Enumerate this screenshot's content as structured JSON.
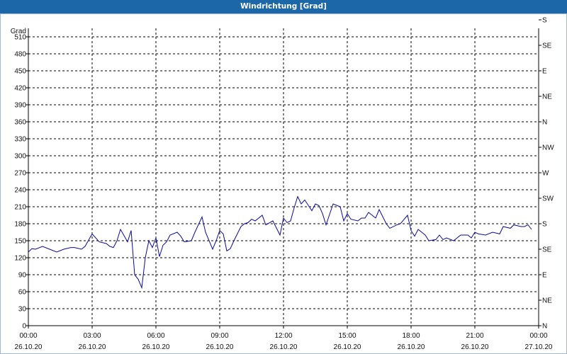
{
  "window": {
    "title": "Windrichtung [Grad]"
  },
  "colors": {
    "title_bar": "#1c67a8",
    "line": "#0a0a9c",
    "grid": "#000000",
    "axis": "#000000"
  },
  "chart_data": {
    "type": "line",
    "title": "Windrichtung [Grad]",
    "ylabel": "Grad",
    "ylim": [
      0,
      525
    ],
    "y_ticks": [
      0,
      30,
      60,
      90,
      120,
      150,
      180,
      210,
      240,
      270,
      300,
      330,
      360,
      390,
      420,
      450,
      480,
      510
    ],
    "y2_ticks": [
      {
        "value": 0,
        "label": "N"
      },
      {
        "value": 45,
        "label": "NE"
      },
      {
        "value": 90,
        "label": "E"
      },
      {
        "value": 135,
        "label": "SE"
      },
      {
        "value": 180,
        "label": "S"
      },
      {
        "value": 225,
        "label": "SW"
      },
      {
        "value": 270,
        "label": "W"
      },
      {
        "value": 315,
        "label": "NW"
      },
      {
        "value": 360,
        "label": "N"
      },
      {
        "value": 405,
        "label": "NE"
      },
      {
        "value": 450,
        "label": "E"
      },
      {
        "value": 495,
        "label": "SE"
      },
      {
        "value": 540,
        "label": "S"
      }
    ],
    "xlim": [
      "26.10.20 00:00",
      "27.10.20 00:00"
    ],
    "x_ticks": [
      {
        "time": "00:00",
        "date": "26.10.20"
      },
      {
        "time": "03:00",
        "date": "26.10.20"
      },
      {
        "time": "06:00",
        "date": "26.10.20"
      },
      {
        "time": "09:00",
        "date": "26.10.20"
      },
      {
        "time": "12:00",
        "date": "26.10.20"
      },
      {
        "time": "15:00",
        "date": "26.10.20"
      },
      {
        "time": "18:00",
        "date": "26.10.20"
      },
      {
        "time": "21:00",
        "date": "26.10.20"
      },
      {
        "time": "00:00",
        "date": "27.10.20"
      }
    ],
    "grid": true,
    "series": [
      {
        "x": [
          "00:00",
          "00:10",
          "00:20",
          "00:40",
          "01:00",
          "01:20",
          "01:40",
          "02:00",
          "02:10",
          "02:30",
          "02:40",
          "03:00",
          "03:20",
          "03:40",
          "03:50",
          "04:00",
          "04:10",
          "04:20",
          "04:40",
          "04:50",
          "05:00",
          "05:10",
          "05:20",
          "05:30",
          "05:40",
          "05:50",
          "06:00",
          "06:10",
          "06:20",
          "06:30",
          "06:40",
          "07:00",
          "07:10",
          "07:20",
          "07:40",
          "07:50",
          "08:10",
          "08:20",
          "08:40",
          "08:50",
          "09:00",
          "09:10",
          "09:20",
          "09:30",
          "09:40",
          "10:00",
          "10:10",
          "10:20",
          "10:30",
          "10:40",
          "11:00",
          "11:10",
          "11:30",
          "11:50",
          "12:00",
          "12:10",
          "12:20",
          "12:30",
          "12:40",
          "12:50",
          "13:00",
          "13:20",
          "13:30",
          "13:40",
          "13:50",
          "14:00",
          "14:20",
          "14:40",
          "14:50",
          "15:00",
          "15:10",
          "15:30",
          "15:40",
          "15:50",
          "16:00",
          "16:20",
          "16:30",
          "16:50",
          "17:00",
          "17:20",
          "17:30",
          "17:50",
          "18:00",
          "18:10",
          "18:20",
          "18:40",
          "18:50",
          "19:10",
          "19:20",
          "19:30",
          "19:40",
          "20:00",
          "20:10",
          "20:20",
          "20:40",
          "20:50",
          "21:00",
          "21:10",
          "21:30",
          "21:50",
          "22:10",
          "22:20",
          "22:40",
          "22:50",
          "23:10",
          "23:20",
          "23:30",
          "23:40"
        ],
        "values": [
          130,
          136,
          135,
          140,
          135,
          130,
          135,
          138,
          138,
          135,
          140,
          162,
          148,
          145,
          140,
          138,
          150,
          170,
          148,
          168,
          90,
          82,
          67,
          120,
          150,
          138,
          155,
          122,
          142,
          148,
          160,
          165,
          158,
          148,
          150,
          165,
          192,
          165,
          135,
          150,
          168,
          162,
          132,
          136,
          150,
          175,
          180,
          182,
          188,
          185,
          195,
          178,
          185,
          160,
          190,
          182,
          185,
          208,
          228,
          215,
          222,
          203,
          215,
          212,
          198,
          178,
          215,
          210,
          185,
          198,
          188,
          185,
          190,
          190,
          200,
          190,
          205,
          180,
          172,
          178,
          180,
          195,
          168,
          158,
          170,
          160,
          150,
          152,
          160,
          152,
          155,
          150,
          155,
          160,
          160,
          155,
          165,
          162,
          160,
          165,
          162,
          175,
          172,
          178,
          175,
          175,
          178,
          170
        ]
      }
    ]
  }
}
